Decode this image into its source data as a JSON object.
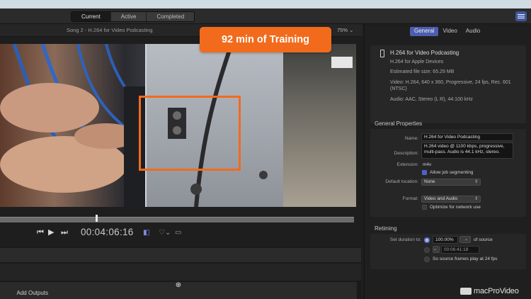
{
  "toolbar": {
    "tabs": [
      {
        "label": "Current",
        "active": true
      },
      {
        "label": "Active",
        "active": false
      },
      {
        "label": "Completed",
        "active": false
      }
    ]
  },
  "viewer": {
    "title": "Song 2 - H.264 for Video Podcasting",
    "zoom": "75%",
    "progress": 0.27
  },
  "banner": {
    "text": "92 min of Training"
  },
  "transport": {
    "timecode": "00:04:06:16"
  },
  "outputs": {
    "add_label": "Add Outputs"
  },
  "inspector": {
    "tabs": [
      {
        "label": "General",
        "active": true
      },
      {
        "label": "Video",
        "active": false
      },
      {
        "label": "Audio",
        "active": false
      }
    ],
    "summary": {
      "name": "H.264 for Video Podcasting",
      "subtitle": "H.264 for Apple Devices",
      "file_size": "Estimated file size: 65.29 MB",
      "video_line1": "Video: H.264, 640 x 360, Progressive, 24 fps, Rec. 601",
      "video_line2": "(NTSC)",
      "audio": "Audio: AAC, Stereo (L R), 44.100 kHz"
    },
    "general_properties": {
      "title": "General Properties",
      "name_label": "Name:",
      "name_value": "H.264 for Video Podcasting",
      "description_label": "Description:",
      "description_line1": "H.264 video @ 1100 kbps, progressive,",
      "description_line2": "multi-pass. Audio is 44.1 kHz, stereo.",
      "extension_label": "Extension:",
      "extension_value": "m4v",
      "job_segmenting_label": "Allow job segmenting",
      "default_location_label": "Default location:",
      "default_location_value": "None",
      "format_label": "Format:",
      "format_value": "Video and Audio",
      "optimize_label": "Optimize for network use"
    },
    "retiming": {
      "title": "Retiming",
      "set_duration_label": "Set duration to:",
      "percent_value": "100.00%",
      "of_source_label": "of source",
      "duration_value": "00:06:41:18",
      "so_source_label": "So source frames play at 24 fps"
    }
  },
  "watermark": {
    "text": "macProVideo"
  },
  "colors": {
    "accent": "#4d62c8",
    "banner": "#f26b1d"
  }
}
